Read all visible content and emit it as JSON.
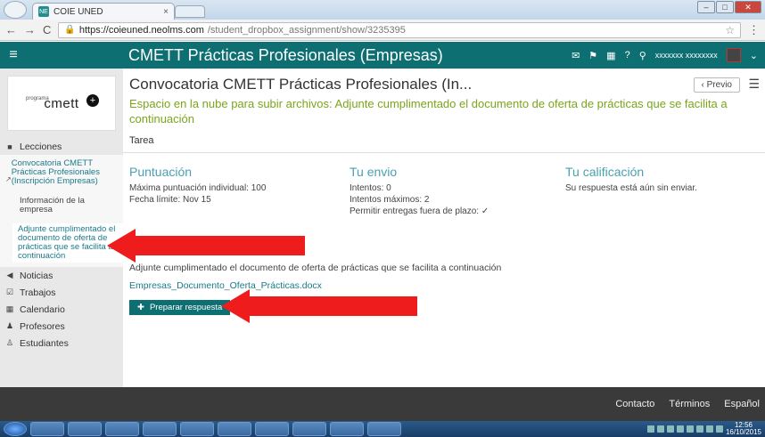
{
  "browser": {
    "tab_title": "COIE UNED",
    "tab_favicon": "NE",
    "url_host": "https://coieuned.neolms.com",
    "url_path": "/student_dropbox_assignment/show/3235395"
  },
  "topbar": {
    "course_title": "CMETT Prácticas Profesionales (Empresas)",
    "user_name": "xxxxxxx xxxxxxxx"
  },
  "sidebar": {
    "logo_small": "programa",
    "logo_main": "cmett",
    "lessons_label": "Lecciones",
    "sub_convocatoria": "Convocatoria CMETT Prácticas Profesionales (Inscripción Empresas)",
    "sub_info": "Información de la empresa",
    "sub_active": "Adjunte cumplimentado el documento de oferta de prácticas que se facilita a continuación",
    "items": [
      {
        "label": "Noticias"
      },
      {
        "label": "Trabajos"
      },
      {
        "label": "Calendario"
      },
      {
        "label": "Profesores"
      },
      {
        "label": "Estudiantes"
      }
    ]
  },
  "main": {
    "title": "Convocatoria CMETT Prácticas Profesionales (In...",
    "pager_label": "Previo",
    "description": "Espacio en la nube para subir archivos: Adjunte cumplimentado el documento de oferta de prácticas que se facilita a continuación",
    "tab_label": "Tarea",
    "puntuacion": {
      "heading": "Puntuación",
      "line1": "Máxima puntuación individual: 100",
      "line2": "Fecha límite: Nov 15"
    },
    "envio": {
      "heading": "Tu envio",
      "line1": "Intentos: 0",
      "line2": "Intentos máximos: 2",
      "line3": "Permitir entregas fuera de plazo: ✓"
    },
    "calificacion": {
      "heading": "Tu calificación",
      "line1": "Su respuesta está aún sin enviar."
    },
    "instructions": "Adjunte cumplimentado el documento de oferta de prácticas que se facilita a continuación",
    "file_link": "Empresas_Documento_Oferta_Prácticas.docx",
    "prepare_button": "Preparar respuesta"
  },
  "footer": {
    "contact": "Contacto",
    "terms": "Términos",
    "language": "Español"
  },
  "taskbar": {
    "time": "12:56",
    "date": "16/10/2015"
  },
  "colors": {
    "teal": "#0e6f73",
    "green_text": "#7aa51a",
    "arrow_red": "#ee1c1c"
  }
}
